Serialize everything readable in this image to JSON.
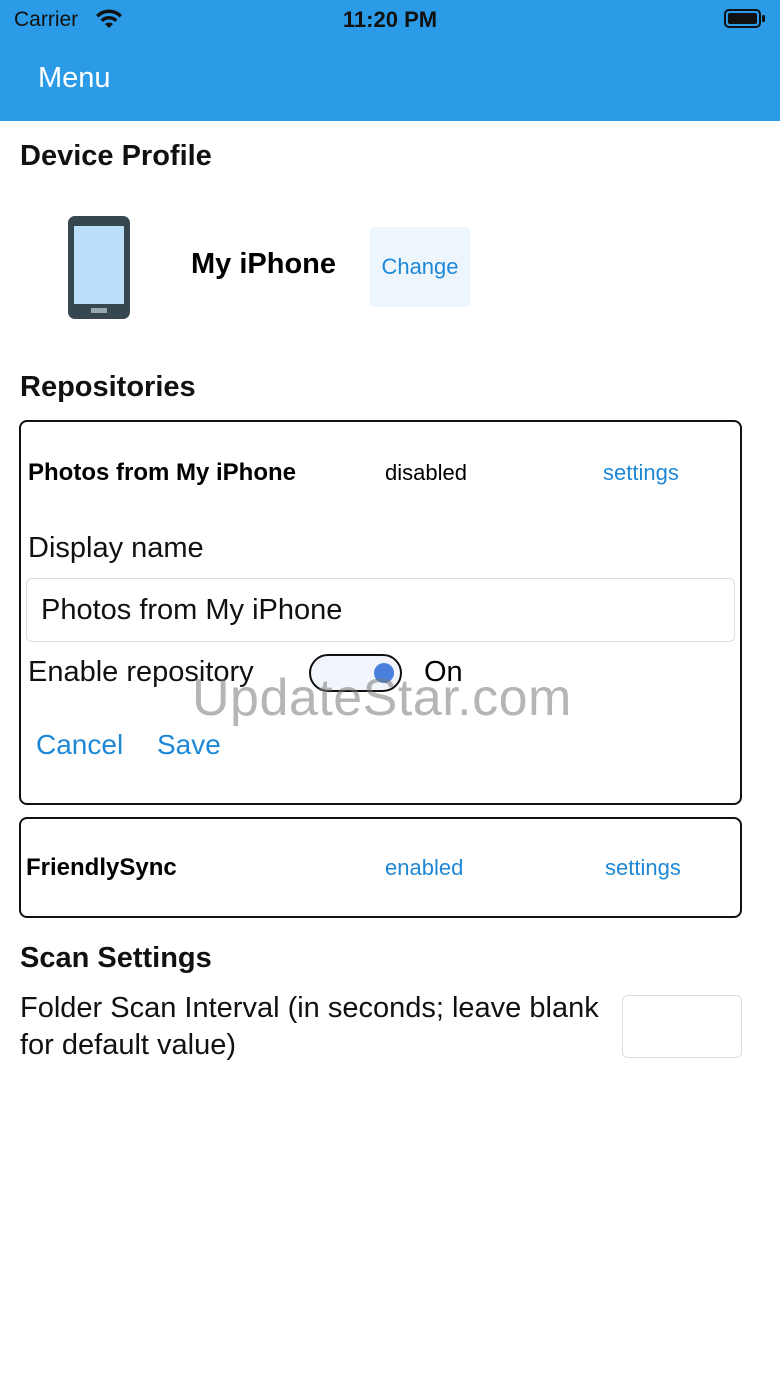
{
  "status_bar": {
    "carrier": "Carrier",
    "time": "11:20 PM"
  },
  "header": {
    "title": "Menu"
  },
  "device_profile": {
    "title": "Device Profile",
    "device_name": "My iPhone",
    "change_label": "Change"
  },
  "repositories": {
    "title": "Repositories",
    "items": [
      {
        "name": "Photos from My iPhone",
        "status": "disabled",
        "settings_label": "settings",
        "display_name_label": "Display name",
        "display_name_value": "Photos from My iPhone",
        "enable_label": "Enable repository",
        "toggle_state": "On",
        "cancel_label": "Cancel",
        "save_label": "Save"
      },
      {
        "name": "FriendlySync",
        "status": "enabled",
        "settings_label": "settings"
      }
    ]
  },
  "scan_settings": {
    "title": "Scan Settings",
    "interval_label": "Folder Scan Interval (in seconds; leave blank for default value)",
    "interval_value": ""
  },
  "watermark": "UpdateStar.com",
  "colors": {
    "header": "#2b9be8",
    "link": "#1e88d6",
    "toggle_knob": "#4a80dc"
  }
}
